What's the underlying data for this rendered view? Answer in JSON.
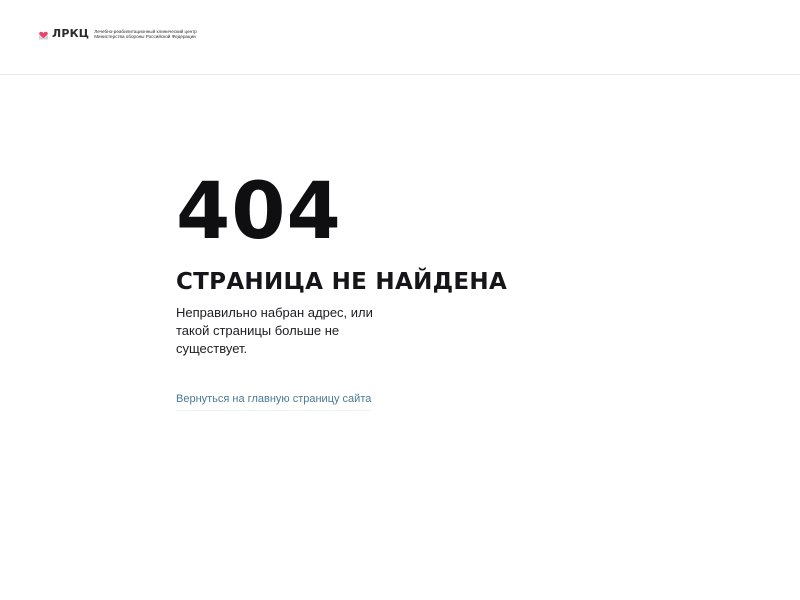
{
  "header": {
    "logo": {
      "icon": "heart-envelope-icon",
      "abbr": "ЛРКЦ",
      "line1": "Лечебно-реабилитационный клинический центр",
      "line2": "Министерства обороны Российской Федерации",
      "accent_color": "#e8436a"
    }
  },
  "error": {
    "code": "404",
    "title": "СТРАНИЦА НЕ НАЙДЕНА",
    "description": "Неправильно набран адрес, или такой страницы больше не существует.",
    "home_link": "Вернуться на главную страницу сайта",
    "link_color": "#4a7a93"
  }
}
